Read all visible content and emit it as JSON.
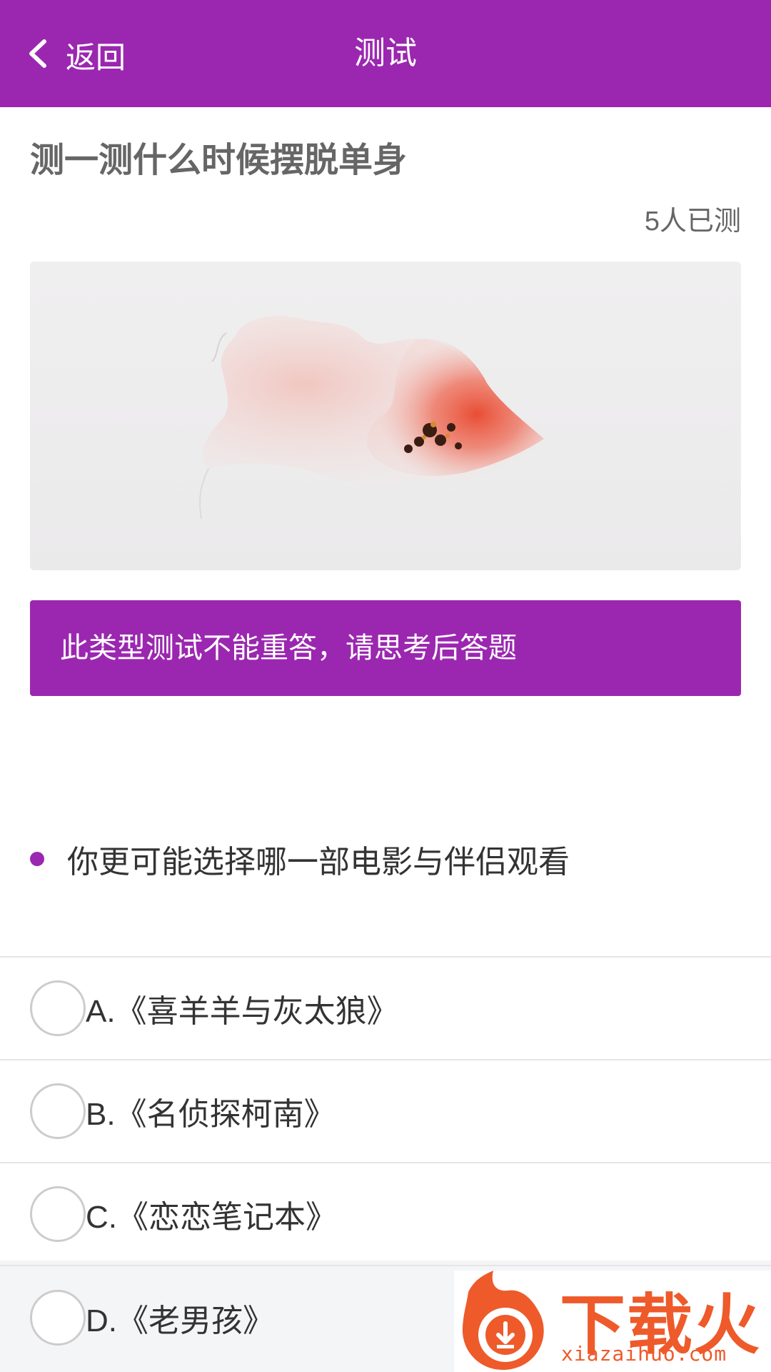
{
  "header": {
    "back_label": "返回",
    "title": "测试"
  },
  "test": {
    "title": "测一测什么时候摆脱单身",
    "tested_count": "5人已测",
    "cover_image": "watercolor-flower-illustration",
    "notice": "此类型测试不能重答，请思考后答题"
  },
  "question": {
    "text": "你更可能选择哪一部电影与伴侣观看",
    "options": [
      {
        "label": "A.《喜羊羊与灰太狼》"
      },
      {
        "label": "B.《名侦探柯南》"
      },
      {
        "label": "C.《恋恋笔记本》"
      },
      {
        "label": "D.《老男孩》"
      }
    ]
  },
  "watermark": {
    "brand": "下载火",
    "domain": "xiazaihuo.com"
  },
  "colors": {
    "accent": "#9b27b0",
    "text_dark": "#333333",
    "text_gray": "#666666",
    "divider": "#e6e6e6",
    "page_bg": "#f4f5f7",
    "watermark": "#ee5a2a"
  },
  "icons": {
    "back": "chevron-left-icon",
    "bullet": "bullet-dot-icon",
    "radio": "radio-unchecked-icon",
    "watermark_logo": "flame-download-logo-icon"
  }
}
